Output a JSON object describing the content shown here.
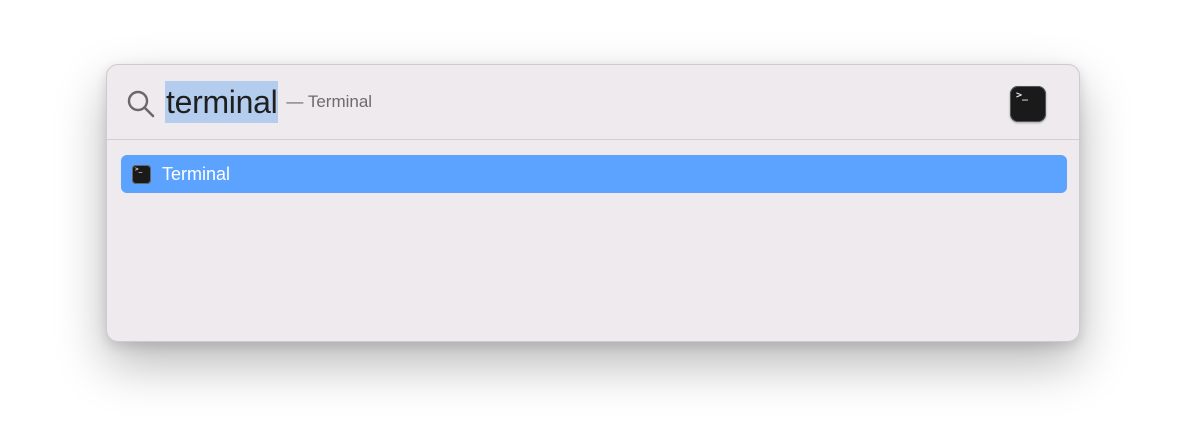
{
  "search": {
    "query": "terminal",
    "suggestion": "— Terminal",
    "top_hit_icon": "terminal-app-icon",
    "top_hit_prompt_glyph": ">_"
  },
  "results": [
    {
      "label": "Terminal",
      "icon": "terminal-app-icon",
      "prompt_glyph": ">_",
      "selected": true
    }
  ],
  "colors": {
    "panel_background": "#efeaee",
    "selection_highlight": "#5ba3ff",
    "query_highlight": "#b4cdee"
  }
}
